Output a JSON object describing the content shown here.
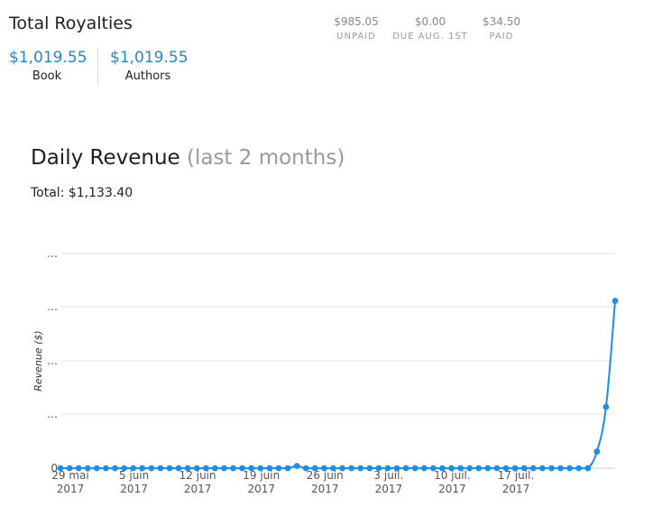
{
  "royalties": {
    "title": "Total Royalties",
    "book_amount": "$1,019.55",
    "book_label": "Book",
    "authors_amount": "$1,019.55",
    "authors_label": "Authors",
    "stats": [
      {
        "value": "$985.05",
        "label": "UNPAID"
      },
      {
        "value": "$0.00",
        "label": "DUE AUG. 1ST"
      },
      {
        "value": "$34.50",
        "label": "PAID"
      }
    ]
  },
  "revenue": {
    "title": "Daily Revenue",
    "subtitle": "(last 2 months)",
    "total": "Total: $1,133.40"
  },
  "colors": {
    "accent": "#1e88d6",
    "series": "#1a8fe8"
  },
  "chart_data": {
    "type": "line",
    "ylabel": "Revenue ($)",
    "xlabel": "",
    "ytick_labels": [
      "0",
      "…",
      "…",
      "…",
      "…"
    ],
    "xticks": [
      {
        "label": [
          "29 mai",
          "2017"
        ],
        "day": 0
      },
      {
        "label": [
          "5 juin",
          "2017"
        ],
        "day": 7
      },
      {
        "label": [
          "12 juin",
          "2017"
        ],
        "day": 14
      },
      {
        "label": [
          "19 juin",
          "2017"
        ],
        "day": 21
      },
      {
        "label": [
          "26 juin",
          "2017"
        ],
        "day": 28
      },
      {
        "label": [
          "3 juil.",
          "2017"
        ],
        "day": 35
      },
      {
        "label": [
          "10 juil.",
          "2017"
        ],
        "day": 42
      },
      {
        "label": [
          "17 juil.",
          "2017"
        ],
        "day": 49
      }
    ],
    "series": [
      {
        "values": [
          0,
          0,
          0,
          0,
          0,
          0,
          0,
          0,
          0,
          0,
          0,
          0,
          0,
          0,
          0,
          0,
          0,
          0,
          0,
          0,
          0,
          0,
          0,
          0,
          0,
          0,
          8,
          0,
          0,
          0,
          0,
          0,
          0,
          0,
          0,
          0,
          0,
          0,
          0,
          0,
          0,
          0,
          0,
          0,
          0,
          0,
          0,
          0,
          0,
          0,
          0,
          0,
          0,
          0,
          0,
          0,
          0,
          0,
          0,
          60,
          220,
          600
        ]
      }
    ],
    "grid": true
  }
}
